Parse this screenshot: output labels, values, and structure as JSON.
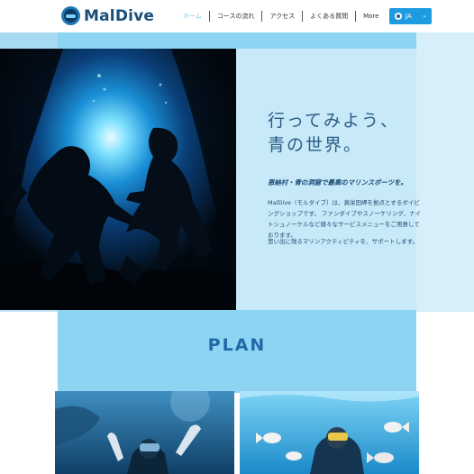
{
  "header": {
    "brand": "MalDive",
    "nav": [
      {
        "label": "ホーム",
        "active": true
      },
      {
        "label": "コースの流れ",
        "active": false
      },
      {
        "label": "アクセス",
        "active": false
      },
      {
        "label": "よくある質問",
        "active": false
      },
      {
        "label": "More",
        "active": false
      }
    ],
    "language": {
      "code": "JA"
    }
  },
  "hero": {
    "headline_line1": "行ってみよう、",
    "headline_line2": "青の世界。",
    "subheading": "恩納村・青の洞窟で最高のマリンスポーツを。",
    "description": "MalDive（モルダイブ）は、真栄田岬を拠点とするダイビングショップです。 ファンダイブやスノーケリング、ナイトシュノーケルなど様々なサービスメニューをご用意しております。",
    "tagline": "思い出に残るマリンアクティビティを、サポートします。"
  },
  "plan": {
    "title": "PLAN"
  },
  "colors": {
    "accent": "#1e9be0",
    "brand_text": "#1a4f7a",
    "headline": "#2a5d86",
    "plan_title": "#1f6aa8"
  }
}
